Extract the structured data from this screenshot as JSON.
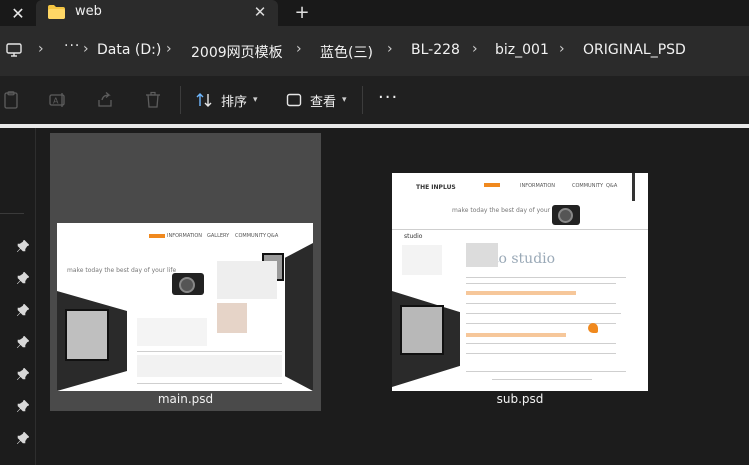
{
  "window": {
    "tab_title": "web",
    "close_glyph": "✕",
    "tab_close_glyph": "✕",
    "new_tab_glyph": "+"
  },
  "address": {
    "more_glyph": "···",
    "separator": "›",
    "breadcrumbs": [
      "Data (D:)",
      "2009网页模板",
      "蓝色(三)",
      "BL-228",
      "biz_001",
      "ORIGINAL_PSD"
    ]
  },
  "toolbar": {
    "sort_label": "排序",
    "view_label": "查看",
    "more_glyph": "···",
    "icons": [
      "paste-icon",
      "rename-icon",
      "share-icon",
      "delete-icon"
    ]
  },
  "files": [
    {
      "name": "main.psd",
      "selected": true
    },
    {
      "name": "sub.psd",
      "selected": false
    }
  ],
  "thumbnails": {
    "main": {
      "tagline": "make today the best day of your life",
      "nav": [
        "INFORMATION",
        "GALLERY",
        "COMMUNITY",
        "Q&A"
      ]
    },
    "sub": {
      "logo": "THE INPLUS",
      "tagline": "make today the best day of your life",
      "section": "studio",
      "heading": "Photo studio",
      "nav": [
        "INFORMATION",
        "COMMUNITY",
        "Q&A"
      ]
    }
  },
  "colors": {
    "accent_orange": "#f0891e",
    "folder_yellow": "#f4c542",
    "selection": "#4a4a4a"
  }
}
